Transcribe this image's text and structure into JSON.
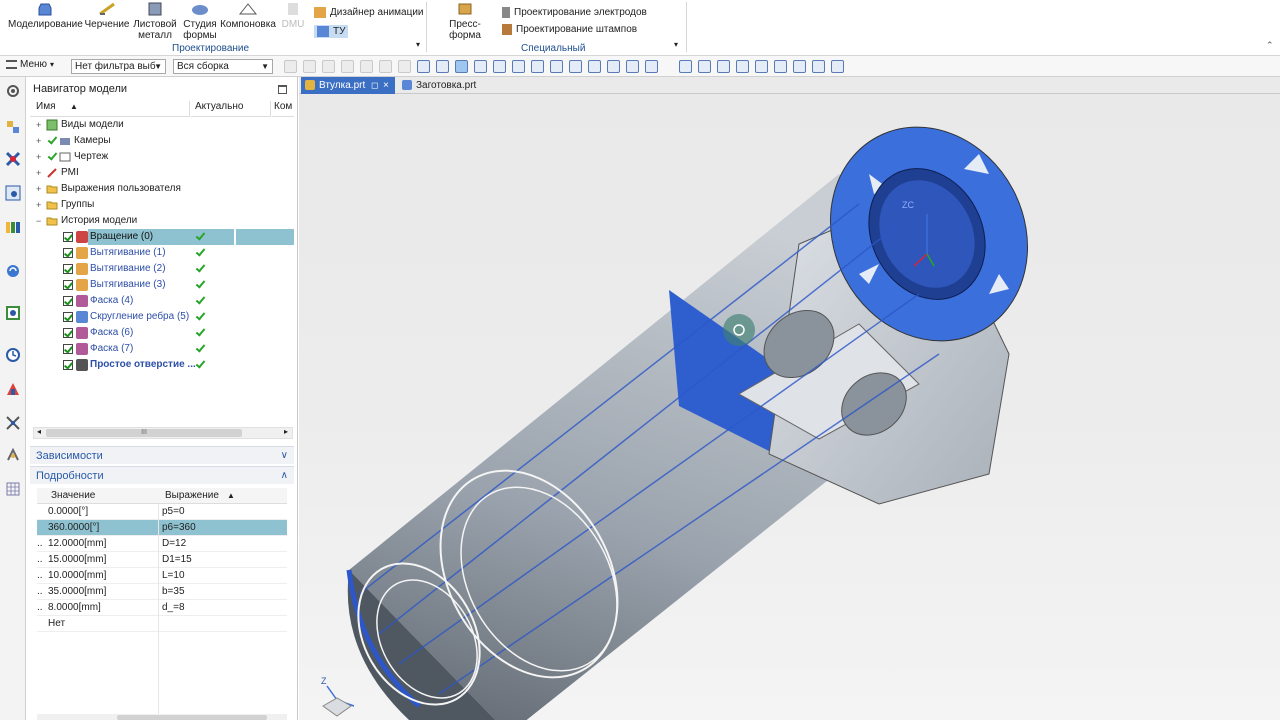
{
  "ribbon": {
    "buttons": [
      {
        "label": "Моделирование"
      },
      {
        "label": "Черчение"
      },
      {
        "label": "Листовой металл"
      },
      {
        "label": "Студия формы"
      },
      {
        "label": "Компоновка"
      },
      {
        "label": "DMU"
      }
    ],
    "small_items": [
      {
        "label": "Дизайнер анимации"
      },
      {
        "label": "ТУ"
      }
    ],
    "design_group_label": "Проектирование",
    "press_form_label": "Пресс-форма",
    "special_items": [
      {
        "label": "Проектирование электродов"
      },
      {
        "label": "Проектирование штампов"
      }
    ],
    "special_group_label": "Специальный"
  },
  "toolbar": {
    "menu_label": "Меню",
    "filter_value": "Нет фильтра выб",
    "assembly_value": "Вся сборка"
  },
  "navigator": {
    "title": "Навигатор модели",
    "columns": [
      "Имя",
      "Актуально",
      "Ком"
    ],
    "nodes": [
      {
        "label": "Виды модели"
      },
      {
        "label": "Камеры"
      },
      {
        "label": "Чертеж"
      },
      {
        "label": "PMI"
      },
      {
        "label": "Выражения пользователя"
      },
      {
        "label": "Группы"
      },
      {
        "label": "История модели"
      }
    ],
    "features": [
      {
        "label": "Вращение (0)",
        "selected": true
      },
      {
        "label": "Вытягивание (1)"
      },
      {
        "label": "Вытягивание (2)"
      },
      {
        "label": "Вытягивание (3)"
      },
      {
        "label": "Фаска (4)"
      },
      {
        "label": "Скругление ребра (5)"
      },
      {
        "label": "Фаска (6)"
      },
      {
        "label": "Фаска (7)"
      },
      {
        "label": "Простое отверстие ..."
      }
    ],
    "scroll_marker": "III"
  },
  "dependencies": {
    "title": "Зависимости"
  },
  "details": {
    "title": "Подробности",
    "columns": [
      "Значение",
      "Выражение"
    ],
    "rows": [
      {
        "value": "0.0000[°]",
        "expr": "p5=0"
      },
      {
        "value": "360.0000[°]",
        "expr": "p6=360"
      },
      {
        "value": "12.0000[mm]",
        "expr": "D=12"
      },
      {
        "value": "15.0000[mm]",
        "expr": "D1=15"
      },
      {
        "value": "10.0000[mm]",
        "expr": "L=10"
      },
      {
        "value": "35.0000[mm]",
        "expr": "b=35"
      },
      {
        "value": "8.0000[mm]",
        "expr": "d_=8"
      },
      {
        "value": "Нет",
        "expr": ""
      }
    ]
  },
  "tabs": [
    {
      "label": "Втулка.prt"
    },
    {
      "label": "Заготовка.prt"
    }
  ],
  "viewport": {
    "triad_label": "ZC",
    "axis_label": "Z"
  },
  "colors": {
    "accent": "#2a5aa8",
    "selection": "#8fc2d0",
    "face_blue": "#3b6fdc",
    "part_gray": "#b4bcc6"
  }
}
